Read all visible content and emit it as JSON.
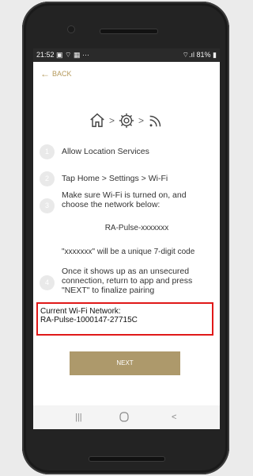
{
  "status_bar": {
    "time": "21:52",
    "left_icons": "▣ ⌔ ▦ ···",
    "right_icons": "⌔.ıl",
    "battery": "81%"
  },
  "back_label": "BACK",
  "breadcrumb": {
    "icons": [
      "home-icon",
      "gear-icon",
      "wifi-icon"
    ],
    "separator": ">"
  },
  "steps": [
    {
      "number": "1",
      "text": "Allow Location Services"
    },
    {
      "number": "2",
      "text": "Tap Home > Settings > Wi-Fi"
    },
    {
      "number": "3",
      "text": "Make sure Wi-Fi is turned on, and choose the network below:"
    },
    {
      "number": "4",
      "text": "Once it shows up as an unsecured connection, return to app and press \"NEXT\" to finalize pairing"
    }
  ],
  "network_name_example": "RA-Pulse-xxxxxxx",
  "code_note": "\"xxxxxxx\" will be a unique 7-digit code",
  "current_network": {
    "label": "Current Wi-Fi Network:",
    "value": "RA-Pulse-1000147-27715C"
  },
  "next_label": "NEXT",
  "colors": {
    "accent": "#b59a5c",
    "button": "#ad996b",
    "highlight": "#e01919"
  }
}
